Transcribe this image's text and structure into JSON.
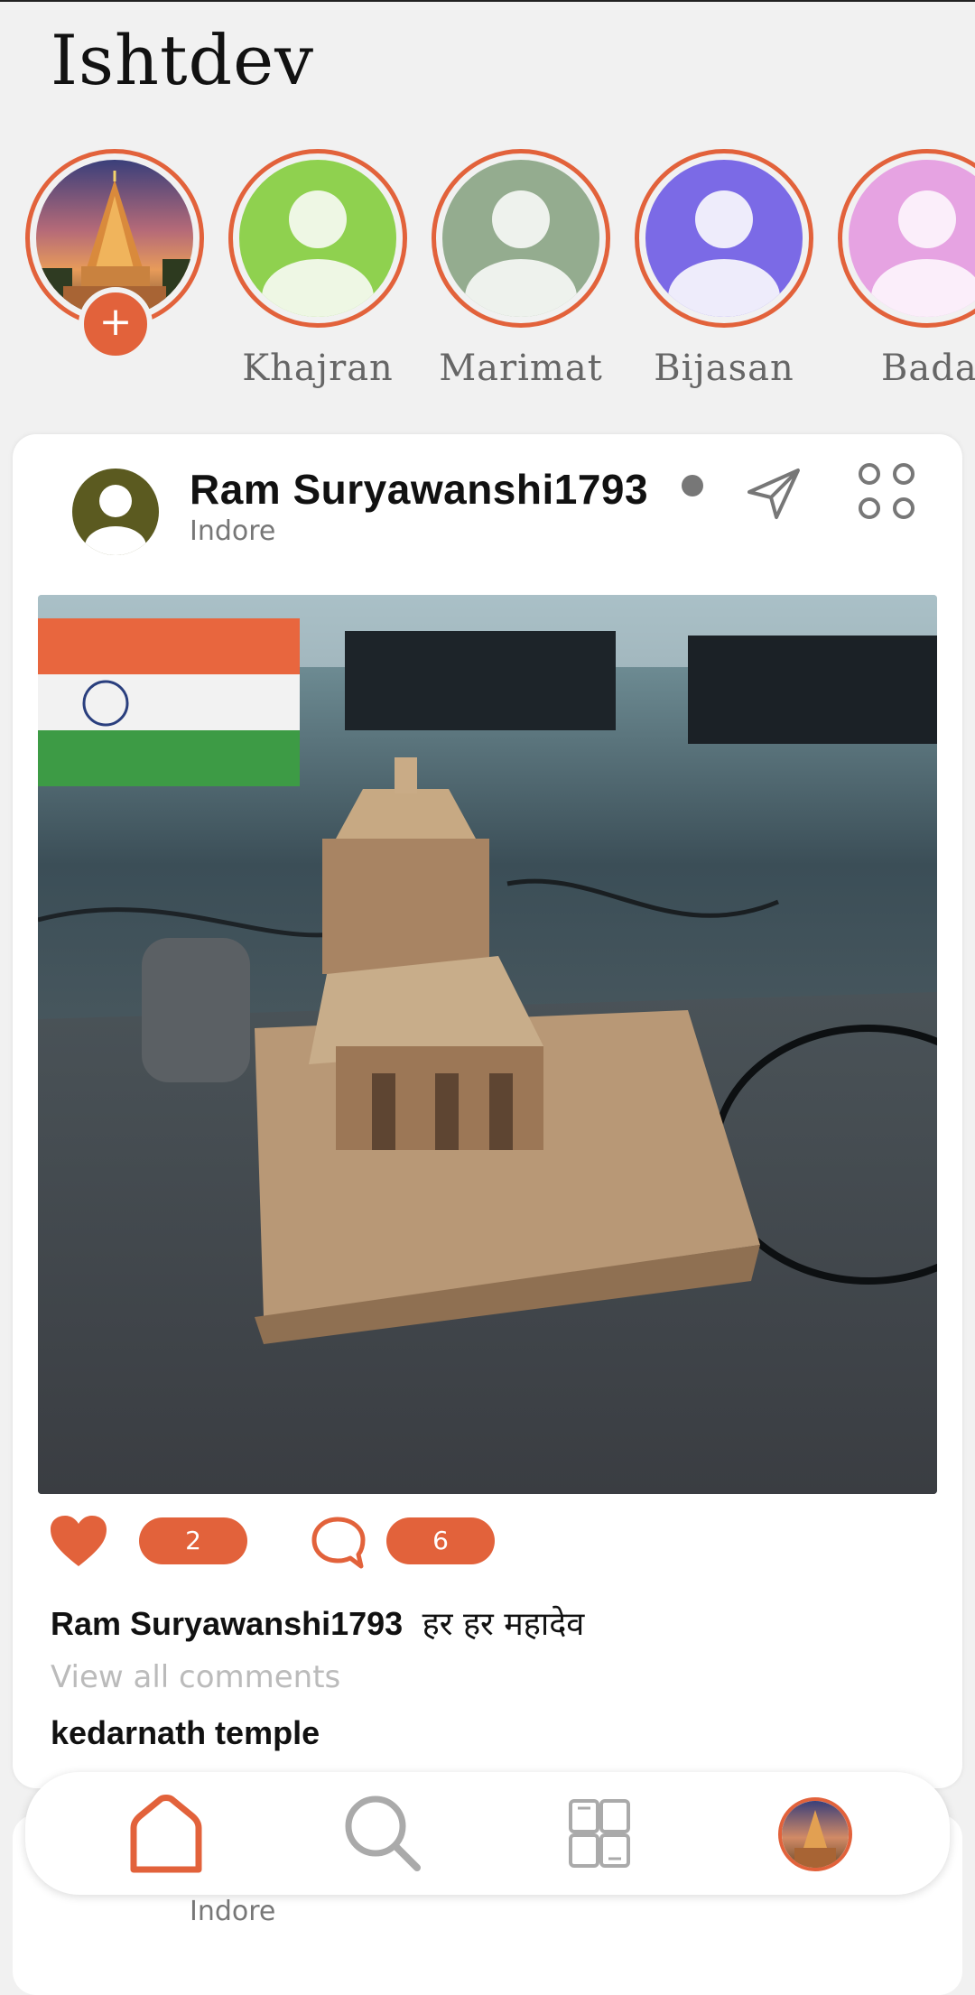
{
  "app": {
    "title": "Ishtdev"
  },
  "stories": [
    {
      "label": "",
      "type": "own",
      "add_symbol": "+"
    },
    {
      "label": "Khajran",
      "color": "#8fd14f"
    },
    {
      "label": "Marimat",
      "color": "#94ac8f"
    },
    {
      "label": "Bijasan",
      "color": "#7b6ae6"
    },
    {
      "label": "Bada",
      "color": "#e6a3e2"
    }
  ],
  "post": {
    "username": "Ram Suryawanshi1793",
    "location": "Indore",
    "likes": "2",
    "comments": "6",
    "caption_user": "Ram Suryawanshi1793",
    "caption_text": "हर हर महादेव",
    "view_comments": "View all comments",
    "location_tag": "kedarnath temple"
  },
  "next_post": {
    "location": "Indore"
  },
  "icons": {
    "send": "send-icon",
    "more": "more-icon",
    "like": "heart-icon",
    "comment": "comment-icon",
    "home": "home-icon",
    "search": "search-icon",
    "community": "community-icon"
  },
  "colors": {
    "accent": "#e2623b",
    "background": "#f1f1f1"
  }
}
